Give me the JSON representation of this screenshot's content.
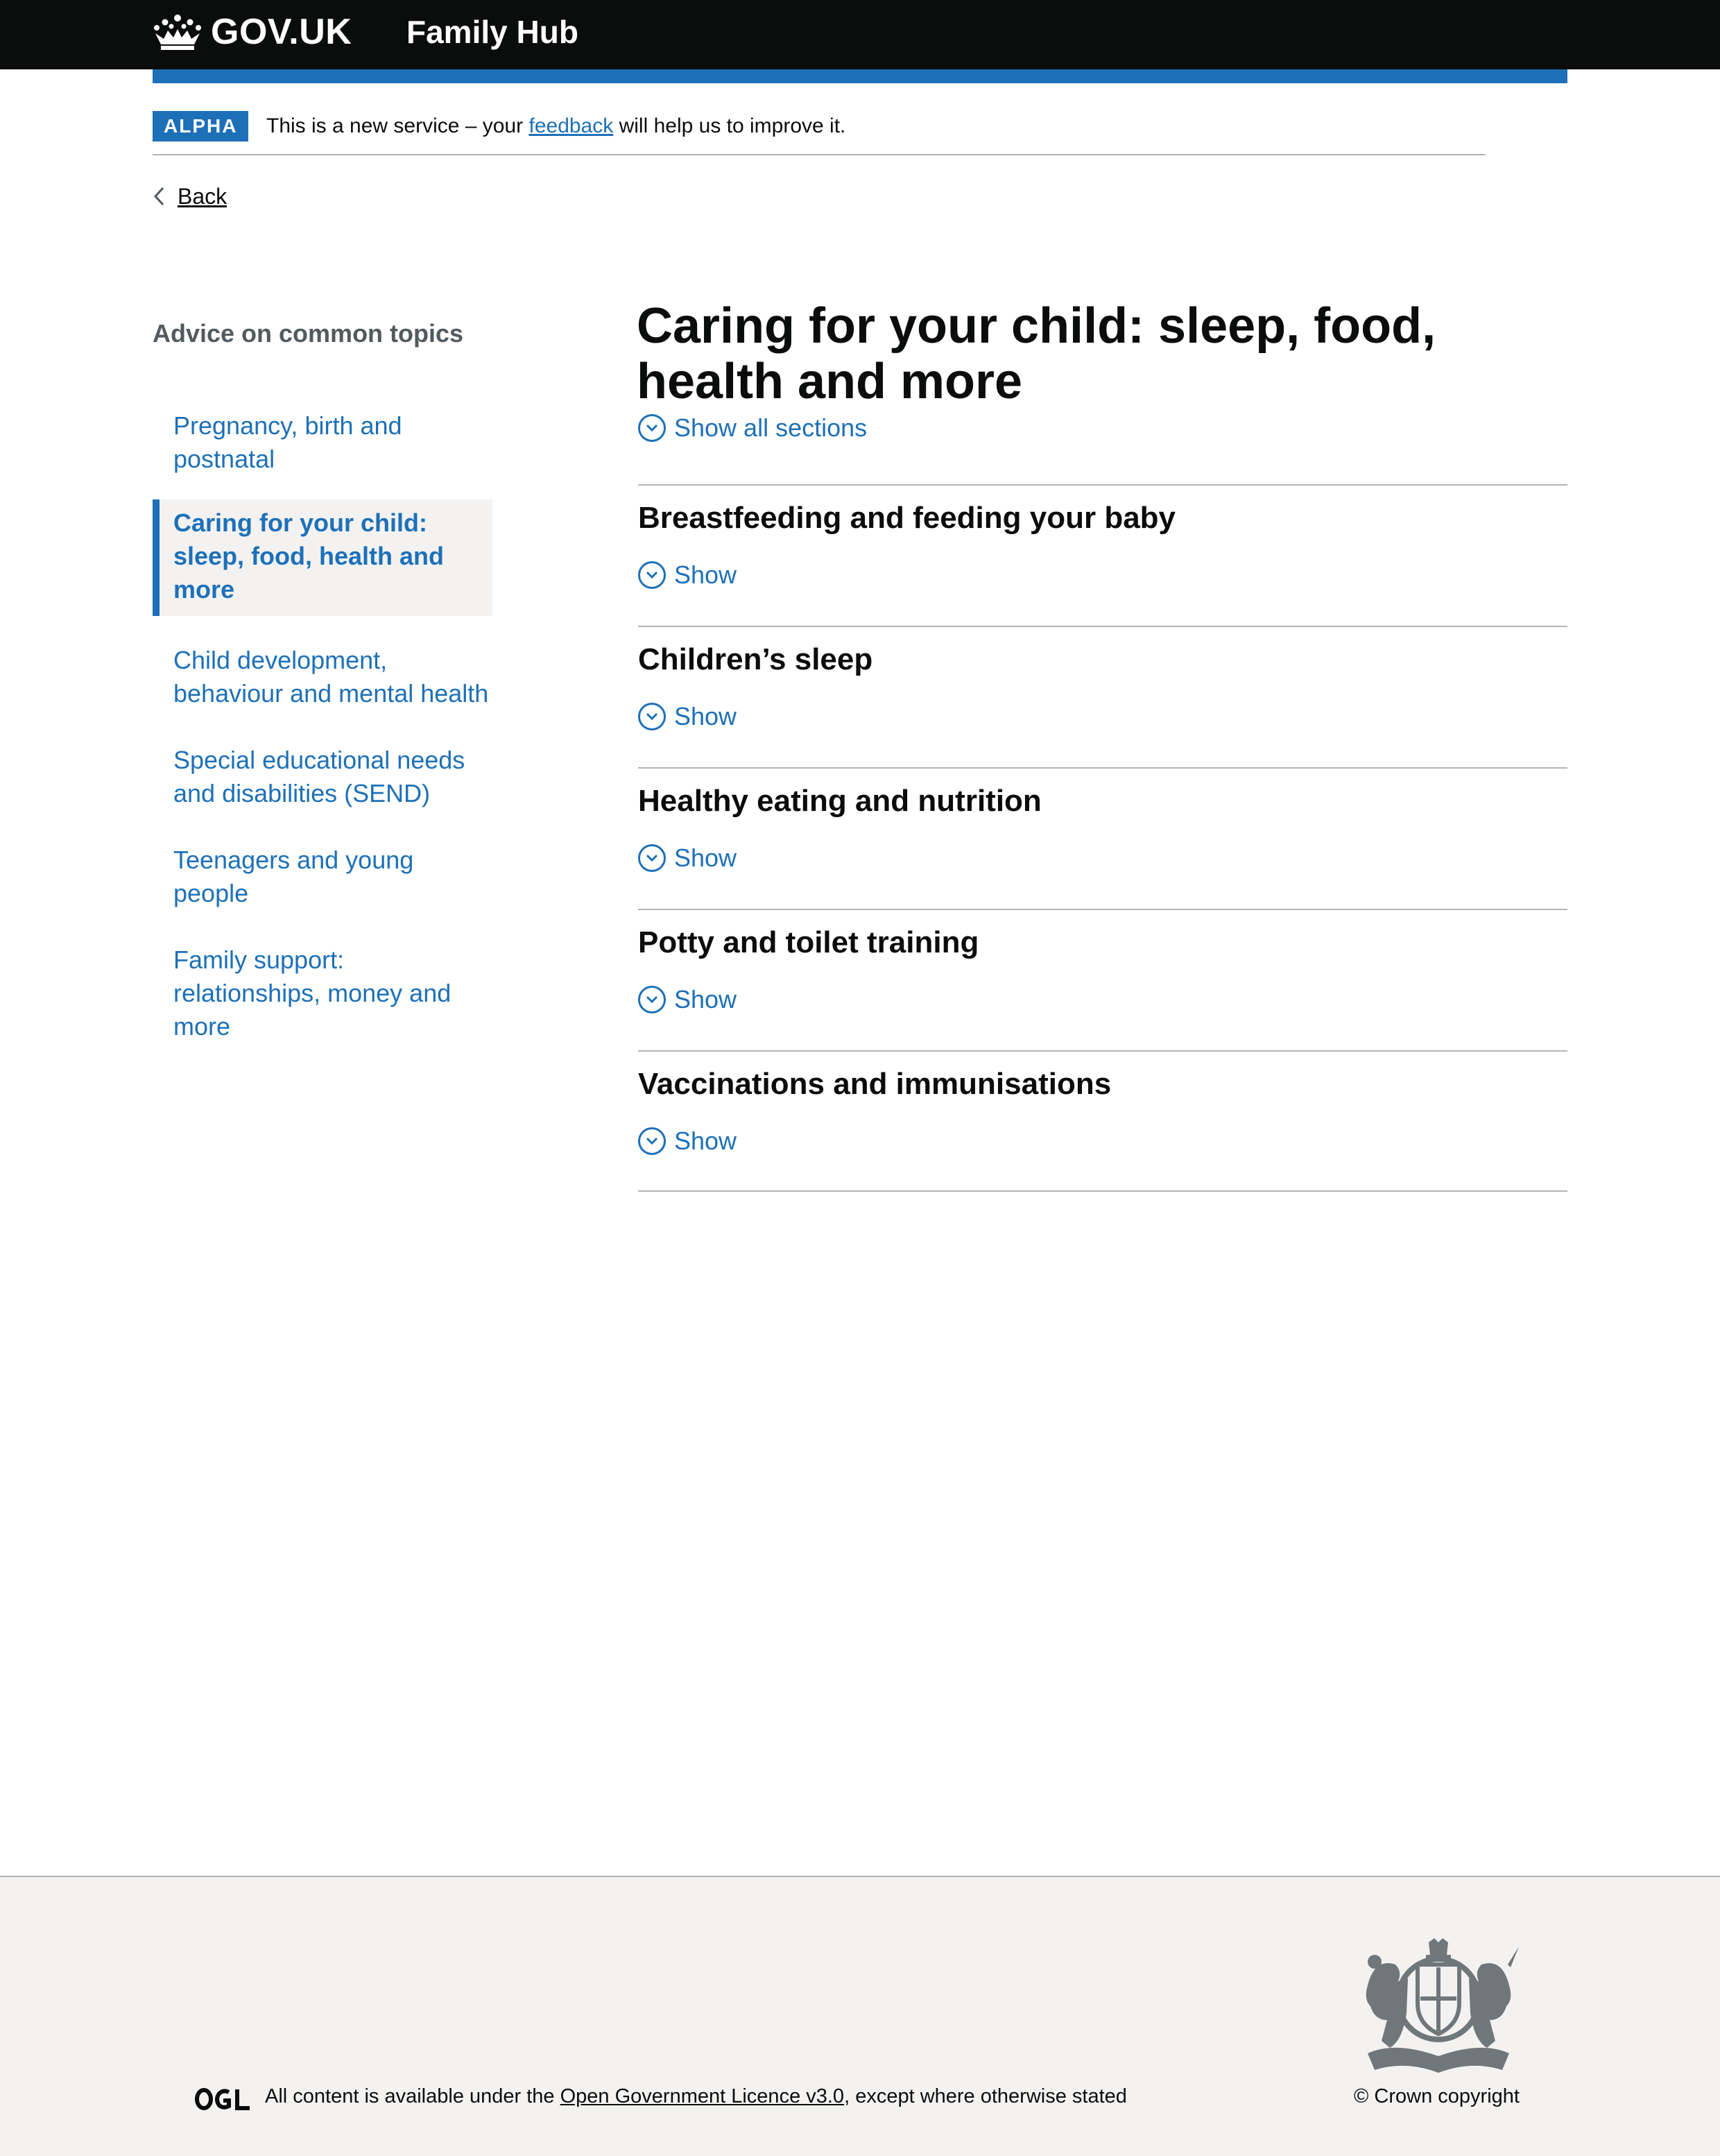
{
  "header": {
    "logo_text": "GOV.UK",
    "service_name": "Family Hub",
    "colors": {
      "background": "#0b0c0c",
      "accent": "#1d70b8"
    }
  },
  "phase_banner": {
    "tag": "ALPHA",
    "text_before": "This is a new service – your ",
    "link_text": "feedback",
    "text_after": " will help us to improve it."
  },
  "back_link": {
    "label": "Back"
  },
  "side_nav": {
    "title": "Advice on common topics",
    "items": [
      {
        "label": "Pregnancy, birth and postnatal",
        "active": false
      },
      {
        "label": "Caring for your child: sleep, food, health and more",
        "active": true
      },
      {
        "label": "Child development, behaviour and mental health",
        "active": false
      },
      {
        "label": "Special educational needs and disabilities (SEND)",
        "active": false
      },
      {
        "label": "Teenagers and young people",
        "active": false
      },
      {
        "label": "Family support: relationships, money and more",
        "active": false
      }
    ]
  },
  "main": {
    "title": "Caring for your child: sleep, food, health and more",
    "show_all_label": "Show all sections",
    "sections": [
      {
        "heading": "Breastfeeding and feeding your baby",
        "toggle": "Show"
      },
      {
        "heading": "Children’s sleep",
        "toggle": "Show"
      },
      {
        "heading": "Healthy eating and nutrition",
        "toggle": "Show"
      },
      {
        "heading": "Potty and toilet training",
        "toggle": "Show"
      },
      {
        "heading": "Vaccinations and immunisations",
        "toggle": "Show"
      }
    ]
  },
  "footer": {
    "ogl_logo": "OGL",
    "licence_before": "All content is available under the ",
    "licence_link": "Open Government Licence v3.0",
    "licence_after": ", except where otherwise stated",
    "copyright": "© Crown copyright",
    "crest_icon": "royal-coat-of-arms-icon"
  }
}
